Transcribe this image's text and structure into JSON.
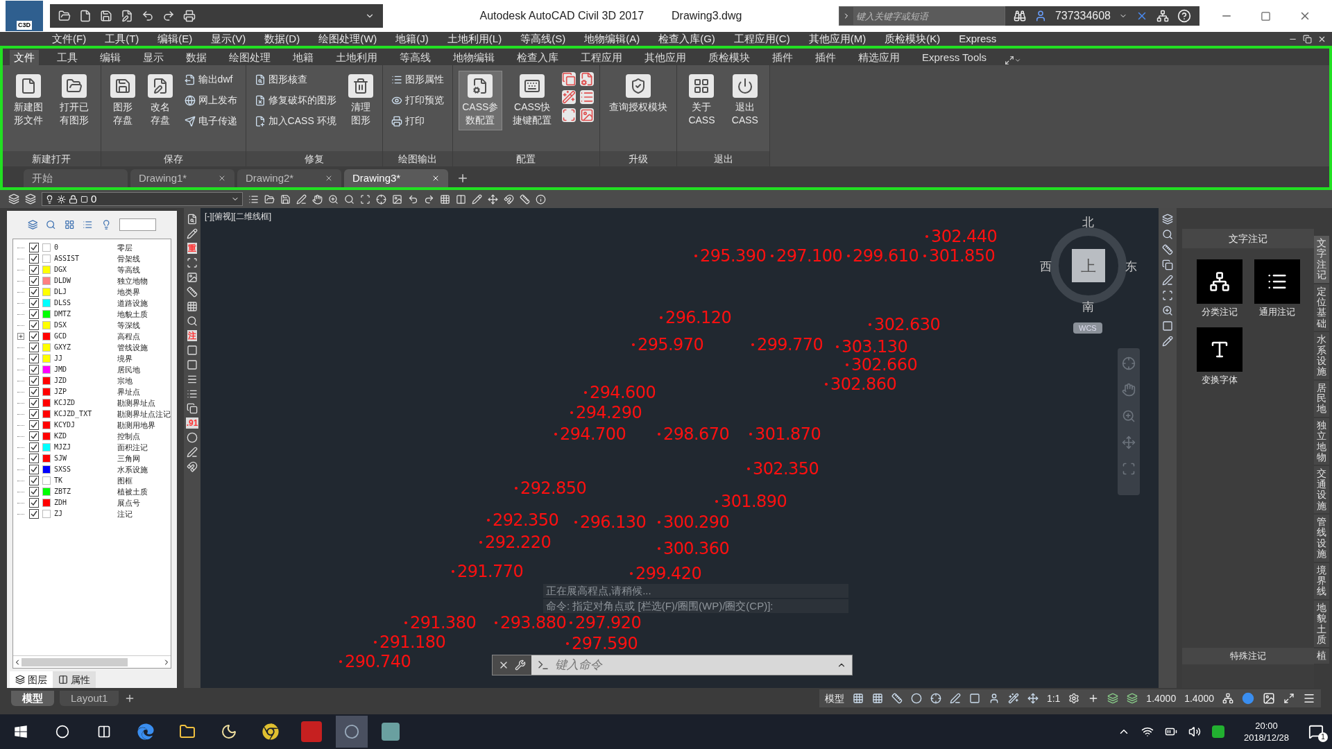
{
  "title_bar": {
    "app_badge": "C3D",
    "title": "Autodesk AutoCAD Civil 3D 2017",
    "file": "Drawing3.dwg",
    "search_placeholder": "键入关键字或短语",
    "user": "737334608"
  },
  "menu_bar": [
    "文件(F)",
    "工具(T)",
    "编辑(E)",
    "显示(V)",
    "数据(D)",
    "绘图处理(W)",
    "地籍(J)",
    "土地利用(L)",
    "等高线(S)",
    "地物编辑(A)",
    "检查入库(G)",
    "工程应用(C)",
    "其他应用(M)",
    "质检模块(K)",
    "Express"
  ],
  "ribbon_tabs": [
    {
      "label": "文件",
      "selected": true
    },
    {
      "label": "工具",
      "selected": false
    },
    {
      "label": "编辑",
      "selected": false
    },
    {
      "label": "显示",
      "selected": false
    },
    {
      "label": "数据",
      "selected": false
    },
    {
      "label": "绘图处理",
      "selected": false
    },
    {
      "label": "地籍",
      "selected": false
    },
    {
      "label": "土地利用",
      "selected": false
    },
    {
      "label": "等高线",
      "selected": false
    },
    {
      "label": "地物编辑",
      "selected": false
    },
    {
      "label": "检查入库",
      "selected": false
    },
    {
      "label": "工程应用",
      "selected": false
    },
    {
      "label": "其他应用",
      "selected": false
    },
    {
      "label": "质检模块",
      "selected": false
    },
    {
      "label": "插件",
      "selected": false
    },
    {
      "label": "插件",
      "selected": false
    },
    {
      "label": "精选应用",
      "selected": false
    },
    {
      "label": "Express Tools",
      "selected": false
    }
  ],
  "ribbon_panels": [
    {
      "title": "新建打开",
      "tools": [
        {
          "label": "新建图形文件",
          "kind": "large",
          "active": false
        },
        {
          "label": "打开已有图形",
          "kind": "large",
          "active": false
        }
      ]
    },
    {
      "title": "保存",
      "tools": [
        {
          "label": "图形存盘",
          "kind": "large",
          "active": false
        },
        {
          "label": "改名存盘",
          "kind": "large",
          "active": false
        },
        {
          "label": "输出dwf",
          "kind": "small",
          "active": false
        },
        {
          "label": "网上发布",
          "kind": "small",
          "active": false
        },
        {
          "label": "电子传递",
          "kind": "small",
          "active": false
        }
      ]
    },
    {
      "title": "修复",
      "tools": [
        {
          "label": "图形核查",
          "kind": "small",
          "active": false
        },
        {
          "label": "修复破坏的图形",
          "kind": "small",
          "active": false
        },
        {
          "label": "加入CASS 环境",
          "kind": "small",
          "active": false
        },
        {
          "label": "清理图形",
          "kind": "large",
          "active": false
        }
      ]
    },
    {
      "title": "绘图输出",
      "tools": [
        {
          "label": "图形属性",
          "kind": "small",
          "active": false
        },
        {
          "label": "打印预览",
          "kind": "small",
          "active": false
        },
        {
          "label": "打印",
          "kind": "small",
          "active": false
        }
      ]
    },
    {
      "title": "配置",
      "tools": [
        {
          "label": "CASS参数配置",
          "kind": "large",
          "active": true
        },
        {
          "label": "CASS快捷键配置",
          "kind": "large",
          "active": false
        }
      ]
    },
    {
      "title": "升级",
      "tools": [
        {
          "label": "查询授权模块",
          "kind": "wide",
          "active": false
        }
      ]
    },
    {
      "title": "退出",
      "tools": [
        {
          "label": "关于CASS",
          "kind": "large",
          "active": false
        },
        {
          "label": "退出CASS",
          "kind": "large",
          "active": false
        }
      ]
    }
  ],
  "document_tabs": [
    {
      "label": "开始",
      "selected": false
    },
    {
      "label": "Drawing1*",
      "selected": false
    },
    {
      "label": "Drawing2*",
      "selected": false
    },
    {
      "label": "Drawing3*",
      "selected": true
    }
  ],
  "layer_toolbar": {
    "layer": "0"
  },
  "side_toolbar_labels": [
    "重",
    "注",
    ".91"
  ],
  "layer_panel": {
    "layers": [
      {
        "name": "0",
        "description": "零层",
        "color": "#ffffff",
        "checked": true,
        "kind": "layer"
      },
      {
        "name": "ASSIST",
        "description": "骨架线",
        "color": "#ffffff",
        "checked": true,
        "kind": "layer"
      },
      {
        "name": "DGX",
        "description": "等高线",
        "color": "#ffff00",
        "checked": true,
        "kind": "layer"
      },
      {
        "name": "DLDW",
        "description": "独立地物",
        "color": "#ff8080",
        "checked": true,
        "kind": "layer"
      },
      {
        "name": "DLJ",
        "description": "地类界",
        "color": "#ffff00",
        "checked": true,
        "kind": "layer"
      },
      {
        "name": "DLSS",
        "description": "道路设施",
        "color": "#00ffff",
        "checked": true,
        "kind": "layer"
      },
      {
        "name": "DMTZ",
        "description": "地貌土质",
        "color": "#00ff00",
        "checked": true,
        "kind": "layer"
      },
      {
        "name": "DSX",
        "description": "等深线",
        "color": "#ffff00",
        "checked": true,
        "kind": "layer"
      },
      {
        "name": "GCD",
        "description": "高程点",
        "color": "#ff0000",
        "checked": true,
        "kind": "group"
      },
      {
        "name": "GXYZ",
        "description": "管线设施",
        "color": "#ffff00",
        "checked": true,
        "kind": "layer"
      },
      {
        "name": "JJ",
        "description": "境界",
        "color": "#ffff00",
        "checked": true,
        "kind": "layer"
      },
      {
        "name": "JMD",
        "description": "居民地",
        "color": "#ff00ff",
        "checked": true,
        "kind": "layer"
      },
      {
        "name": "JZD",
        "description": "宗地",
        "color": "#ff0000",
        "checked": true,
        "kind": "layer"
      },
      {
        "name": "JZP",
        "description": "界址点",
        "color": "#ff0000",
        "checked": true,
        "kind": "layer"
      },
      {
        "name": "KCJZD",
        "description": "勘测界址点",
        "color": "#ff0000",
        "checked": true,
        "kind": "layer"
      },
      {
        "name": "KCJZD_TXT",
        "description": "勘测界址点注记",
        "color": "#ff0000",
        "checked": true,
        "kind": "layer"
      },
      {
        "name": "KCYDJ",
        "description": "勘测用地界",
        "color": "#ff0000",
        "checked": true,
        "kind": "layer"
      },
      {
        "name": "KZD",
        "description": "控制点",
        "color": "#ff0000",
        "checked": true,
        "kind": "layer"
      },
      {
        "name": "MJZJ",
        "description": "面积注记",
        "color": "#00ffff",
        "checked": true,
        "kind": "layer"
      },
      {
        "name": "SJW",
        "description": "三角网",
        "color": "#ff0000",
        "checked": true,
        "kind": "layer"
      },
      {
        "name": "SXSS",
        "description": "水系设施",
        "color": "#0000ff",
        "checked": true,
        "kind": "layer"
      },
      {
        "name": "TK",
        "description": "图框",
        "color": "#ffffff",
        "checked": true,
        "kind": "layer"
      },
      {
        "name": "ZBTZ",
        "description": "植被土质",
        "color": "#00ff00",
        "checked": true,
        "kind": "layer"
      },
      {
        "name": "ZDH",
        "description": "展点号",
        "color": "#ff0000",
        "checked": true,
        "kind": "layer"
      },
      {
        "name": "ZJ",
        "description": "注记",
        "color": "#ffffff",
        "checked": true,
        "kind": "layer"
      }
    ],
    "tabs": [
      {
        "label": "图层",
        "selected": true
      },
      {
        "label": "属性",
        "selected": false
      }
    ]
  },
  "viewport": {
    "label": "[-][俯视][二维线框]",
    "points": [
      "302.440",
      "295.390",
      "297.100",
      "299.610",
      "301.850",
      "296.120",
      "302.630",
      "295.970",
      "299.770",
      "303.130",
      "302.660",
      "302.860",
      "294.600",
      "294.290",
      "294.700",
      "298.670",
      "301.870",
      "302.350",
      "292.850",
      "301.890",
      "292.350",
      "296.130",
      "300.290",
      "292.220",
      "300.360",
      "291.770",
      "299.420",
      "291.380",
      "293.880",
      "297.920",
      "291.180",
      "297.590",
      "290.740"
    ],
    "compass": {
      "north": "北",
      "south": "南",
      "east": "东",
      "west": "西",
      "face": "上",
      "ucs": "WCS"
    },
    "command_history": [
      "正在展高程点,请稍候...",
      "命令: 指定对角点或 [栏选(F)/圈围(WP)/圈交(CP)]:"
    ],
    "command_placeholder": "键入命令"
  },
  "palette": {
    "title": "文字注记",
    "items": [
      "分类注记",
      "通用注记",
      "变换字体"
    ],
    "footer": "特殊注记",
    "side_tabs": [
      {
        "label": "文字注记",
        "selected": true
      },
      {
        "label": "定位基础",
        "selected": false
      },
      {
        "label": "水系设施",
        "selected": false
      },
      {
        "label": "居民地",
        "selected": false
      },
      {
        "label": "独立地物",
        "selected": false
      },
      {
        "label": "交通设施",
        "selected": false
      },
      {
        "label": "管线设施",
        "selected": false
      },
      {
        "label": "境界线",
        "selected": false
      },
      {
        "label": "地貌土质",
        "selected": false
      },
      {
        "label": "植",
        "selected": false
      }
    ]
  },
  "layout_tabs": [
    {
      "label": "模型",
      "selected": true
    },
    {
      "label": "Layout1",
      "selected": false
    }
  ],
  "status_bar": {
    "model": "模型",
    "scale": "1:1",
    "values": [
      "1.4000",
      "1.4000"
    ]
  },
  "taskbar": {
    "time": "20:00",
    "date": "2018/12/28",
    "notifications": "1"
  }
}
